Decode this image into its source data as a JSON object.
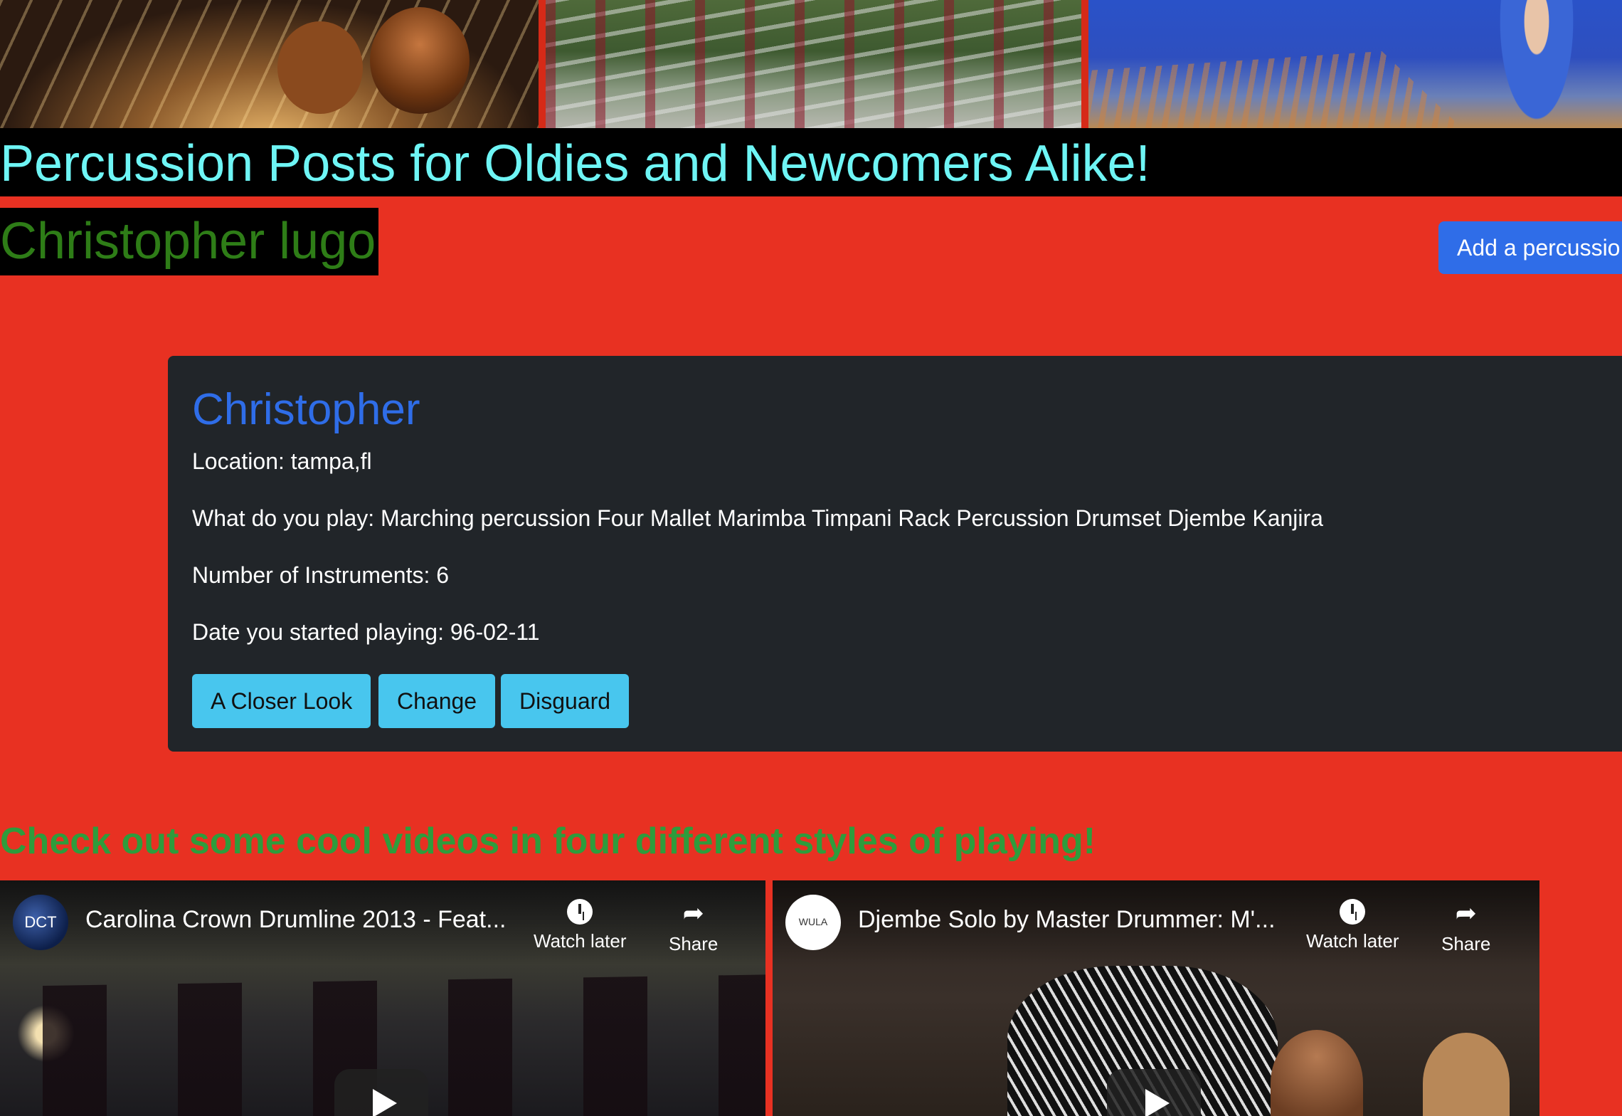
{
  "site_title": "Percussion Posts for Oldies and Newcomers Alike!",
  "user_name": "Christopher lugo",
  "add_button_label": "Add a percussio",
  "post": {
    "name": "Christopher",
    "location_line": "Location: tampa,fl",
    "plays_line": "What do you play: Marching percussion Four Mallet Marimba Timpani Rack Percussion Drumset Djembe Kanjira",
    "instruments_line": "Number of Instruments: 6",
    "started_line": "Date you started playing: 96-02-11",
    "buttons": [
      "A Closer Look",
      "Change",
      "Disguard"
    ]
  },
  "videos_heading": "Check out some cool videos in four different styles of playing!",
  "videos": [
    {
      "title": "Carolina Crown Drumline 2013 - Feat...",
      "channel_logo_text": "DCT",
      "watch_later": "Watch later",
      "share": "Share"
    },
    {
      "title": "Djembe Solo by Master Drummer: M'...",
      "channel_logo_text": "WULA",
      "watch_later": "Watch later",
      "share": "Share"
    }
  ],
  "colors": {
    "page_bg": "#e83122",
    "title_text": "#6ef5f5",
    "user_name_text": "#2e7d17",
    "primary_button": "#2f6de8",
    "card_bg": "#212529",
    "card_title": "#2f6de8",
    "info_button": "#48c6ee",
    "videos_heading": "#2e9c3c"
  }
}
